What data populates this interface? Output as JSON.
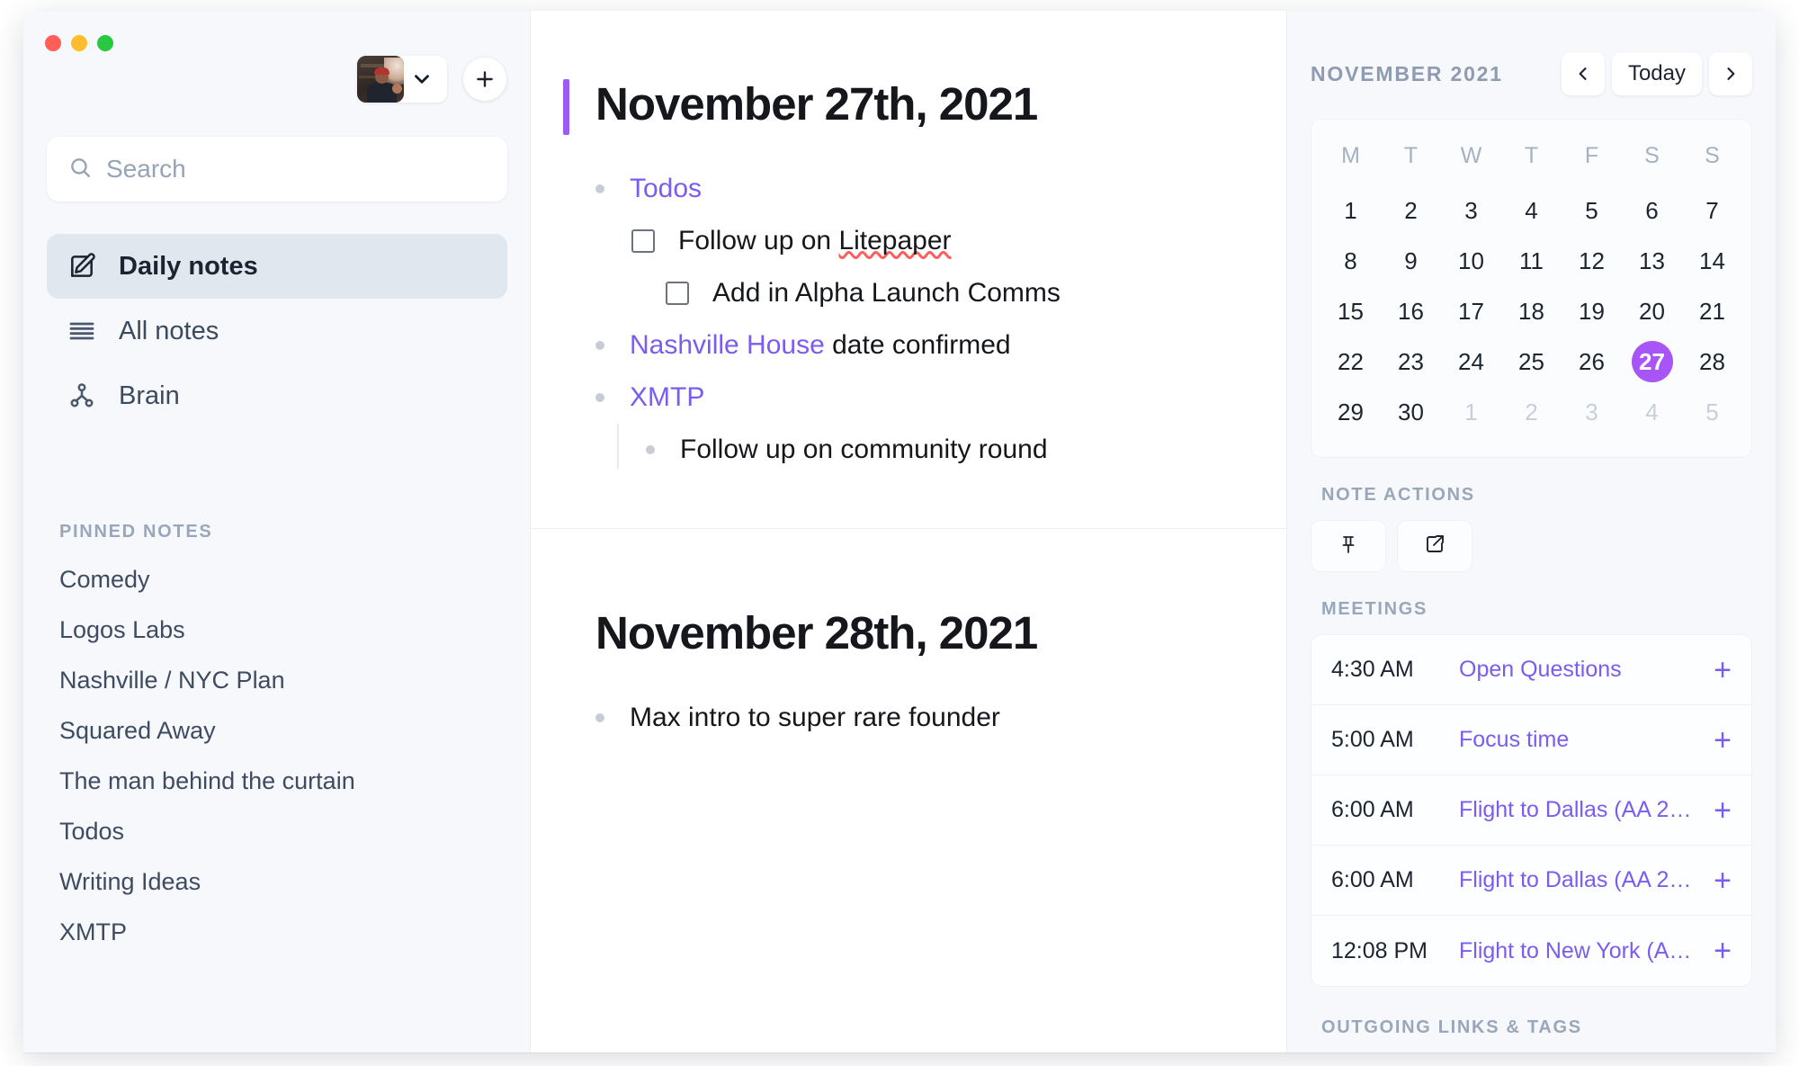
{
  "window": {
    "traffic_lights": [
      "close",
      "minimize",
      "maximize"
    ]
  },
  "sidebar": {
    "account": {
      "avatar_alt": "user-avatar-photo",
      "chevron": "chevron-down-icon"
    },
    "new_note_button": "+",
    "search": {
      "placeholder": "Search",
      "value": "",
      "icon": "search-icon"
    },
    "nav": [
      {
        "label": "Daily notes",
        "icon": "pencil-square-icon",
        "active": true
      },
      {
        "label": "All notes",
        "icon": "list-lines-icon",
        "active": false
      },
      {
        "label": "Brain",
        "icon": "graph-nodes-icon",
        "active": false
      }
    ],
    "pinned_header": "Pinned notes",
    "pinned_notes": [
      "Comedy",
      "Logos Labs",
      "Nashville / NYC Plan",
      "Squared Away",
      "The man behind the curtain",
      "Todos",
      "Writing Ideas",
      "XMTP"
    ]
  },
  "main": {
    "notes": [
      {
        "title": "November 27th, 2021",
        "has_accent_bar": true,
        "items": [
          {
            "kind": "bullet",
            "indent": 0,
            "segments": [
              {
                "text": "Todos",
                "style": "link"
              }
            ]
          },
          {
            "kind": "checkbox",
            "indent": 1,
            "checked": false,
            "segments": [
              {
                "text": "Follow up on ",
                "style": "plain"
              },
              {
                "text": "Litepaper",
                "style": "spell"
              }
            ]
          },
          {
            "kind": "checkbox",
            "indent": 2,
            "checked": false,
            "segments": [
              {
                "text": "Add in Alpha Launch Comms",
                "style": "plain"
              }
            ]
          },
          {
            "kind": "bullet",
            "indent": 0,
            "segments": [
              {
                "text": "Nashville House",
                "style": "link"
              },
              {
                "text": " date confirmed",
                "style": "plain"
              }
            ]
          },
          {
            "kind": "bullet",
            "indent": 0,
            "segments": [
              {
                "text": "XMTP",
                "style": "link"
              }
            ]
          },
          {
            "kind": "bullet",
            "indent": 1,
            "nested": true,
            "segments": [
              {
                "text": "Follow up on community round",
                "style": "plain"
              }
            ]
          }
        ]
      },
      {
        "title": "November 28th, 2021",
        "has_accent_bar": false,
        "items": [
          {
            "kind": "bullet",
            "indent": 0,
            "segments": [
              {
                "text": "Max intro to super rare founder",
                "style": "plain"
              }
            ]
          }
        ]
      }
    ]
  },
  "right_panel": {
    "calendar": {
      "month_label": "November 2021",
      "prev_icon": "chevron-left-icon",
      "today_label": "Today",
      "next_icon": "chevron-right-icon",
      "day_headers": [
        "M",
        "T",
        "W",
        "T",
        "F",
        "S",
        "S"
      ],
      "weeks": [
        [
          {
            "d": "1"
          },
          {
            "d": "2"
          },
          {
            "d": "3"
          },
          {
            "d": "4"
          },
          {
            "d": "5"
          },
          {
            "d": "6"
          },
          {
            "d": "7"
          }
        ],
        [
          {
            "d": "8"
          },
          {
            "d": "9"
          },
          {
            "d": "10"
          },
          {
            "d": "11"
          },
          {
            "d": "12"
          },
          {
            "d": "13"
          },
          {
            "d": "14"
          }
        ],
        [
          {
            "d": "15"
          },
          {
            "d": "16"
          },
          {
            "d": "17"
          },
          {
            "d": "18"
          },
          {
            "d": "19"
          },
          {
            "d": "20"
          },
          {
            "d": "21"
          }
        ],
        [
          {
            "d": "22"
          },
          {
            "d": "23"
          },
          {
            "d": "24"
          },
          {
            "d": "25"
          },
          {
            "d": "26"
          },
          {
            "d": "27",
            "today": true
          },
          {
            "d": "28"
          }
        ],
        [
          {
            "d": "29"
          },
          {
            "d": "30"
          },
          {
            "d": "1",
            "muted": true
          },
          {
            "d": "2",
            "muted": true
          },
          {
            "d": "3",
            "muted": true
          },
          {
            "d": "4",
            "muted": true
          },
          {
            "d": "5",
            "muted": true
          }
        ]
      ]
    },
    "note_actions": {
      "label": "Note actions",
      "buttons": [
        {
          "icon": "pin-icon",
          "name": "pin-note-button"
        },
        {
          "icon": "open-external-icon",
          "name": "open-external-button"
        }
      ]
    },
    "meetings": {
      "label": "Meetings",
      "rows": [
        {
          "time": "4:30 AM",
          "title": "Open Questions",
          "add": "+"
        },
        {
          "time": "5:00 AM",
          "title": "Focus time",
          "add": "+"
        },
        {
          "time": "6:00 AM",
          "title": "Flight to Dallas (AA 2…",
          "add": "+"
        },
        {
          "time": "6:00 AM",
          "title": "Flight to Dallas (AA 2…",
          "add": "+"
        },
        {
          "time": "12:08 PM",
          "title": "Flight to New York (A…",
          "add": "+"
        }
      ]
    },
    "outgoing_label": "Outgoing links & tags"
  },
  "colors": {
    "accent_purple": "#7b5cf0",
    "today_purple": "#a855f7",
    "title_bar_purple": "#9b5cf6",
    "sidebar_bg": "#f6f8fb",
    "main_bg": "#ffffff",
    "active_nav_bg": "#e1e7ef",
    "muted_text": "#9aa7ba",
    "spell_error": "#ff5c5c"
  }
}
